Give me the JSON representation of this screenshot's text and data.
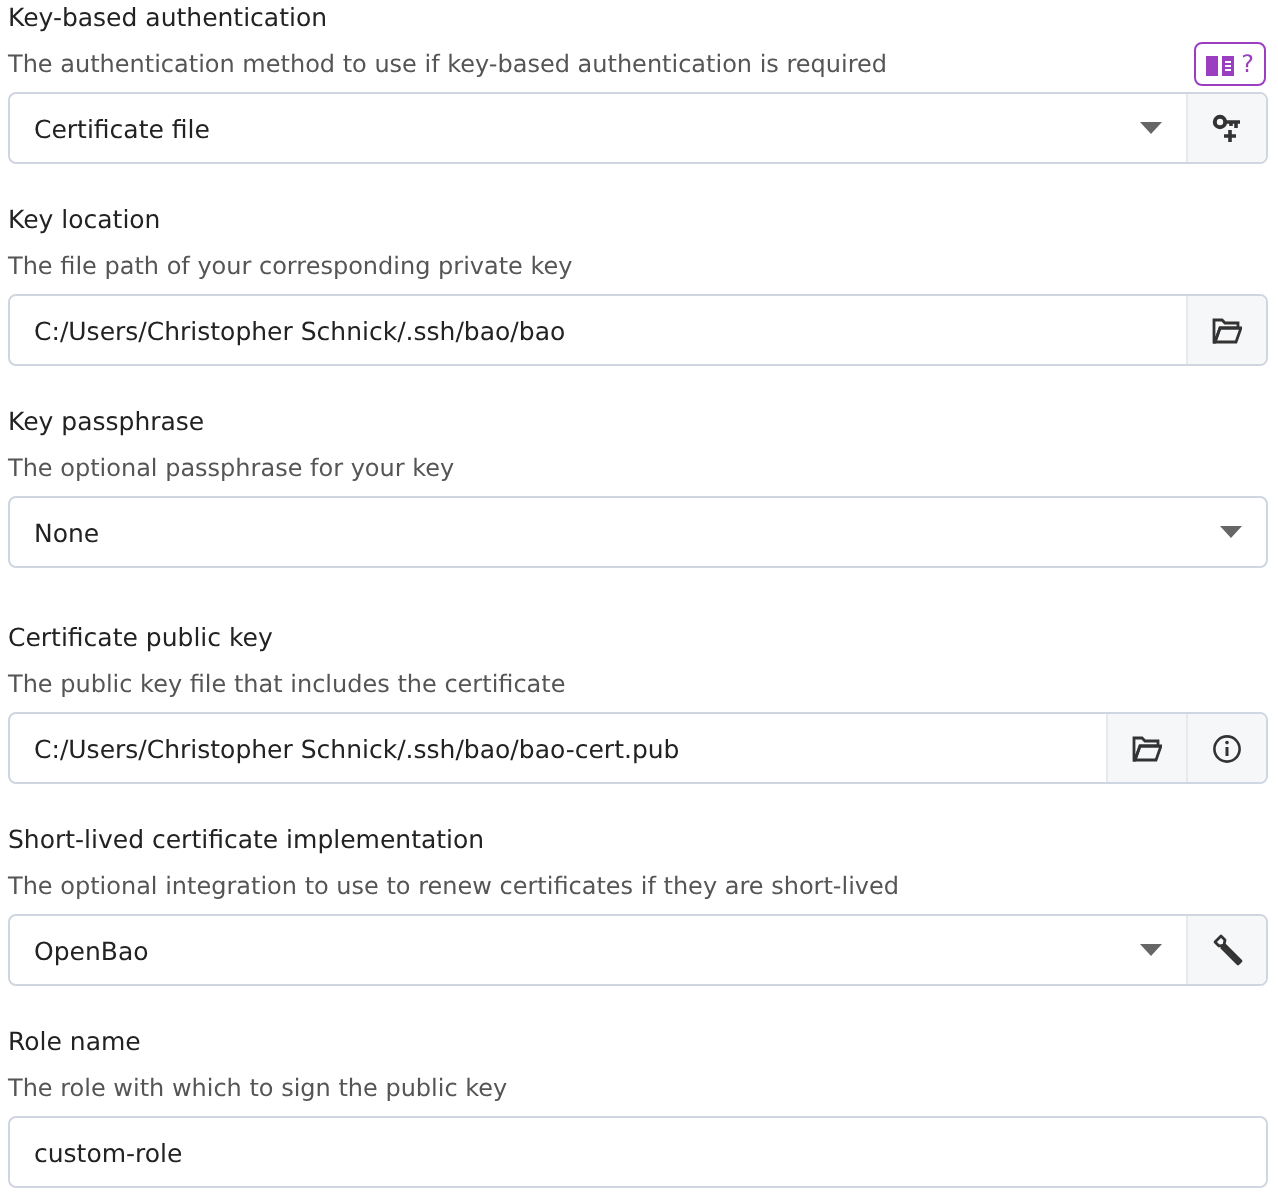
{
  "sections": [
    {
      "label": "Key-based authentication",
      "description": "The authentication method to use if key-based authentication is required",
      "help": {
        "text": "?"
      },
      "field": {
        "kind": "select",
        "value": "Certificate file",
        "actions": [
          {
            "kind": "key"
          }
        ]
      }
    },
    {
      "label": "Key location",
      "description": "The file path of your corresponding private key",
      "field": {
        "kind": "text",
        "value": "C:/Users/Christopher Schnick/.ssh/bao/bao",
        "actions": [
          {
            "kind": "folder"
          }
        ]
      }
    },
    {
      "label": "Key passphrase",
      "description": "The optional passphrase for your key",
      "field": {
        "kind": "select",
        "value": "None"
      }
    },
    {
      "label": "Certificate public key",
      "description": "The public key file that includes the certificate",
      "field": {
        "kind": "text",
        "value": "C:/Users/Christopher Schnick/.ssh/bao/bao-cert.pub",
        "actions": [
          {
            "kind": "folder"
          },
          {
            "kind": "info"
          }
        ]
      }
    },
    {
      "label": "Short-lived certificate implementation",
      "description": "The optional integration to use to renew certificates if they are short-lived",
      "field": {
        "kind": "select",
        "value": "OpenBao",
        "actions": [
          {
            "kind": "wrench"
          }
        ]
      }
    },
    {
      "label": "Role name",
      "description": "The role with which to sign the public key",
      "field": {
        "kind": "text",
        "value": "custom-role"
      }
    }
  ]
}
